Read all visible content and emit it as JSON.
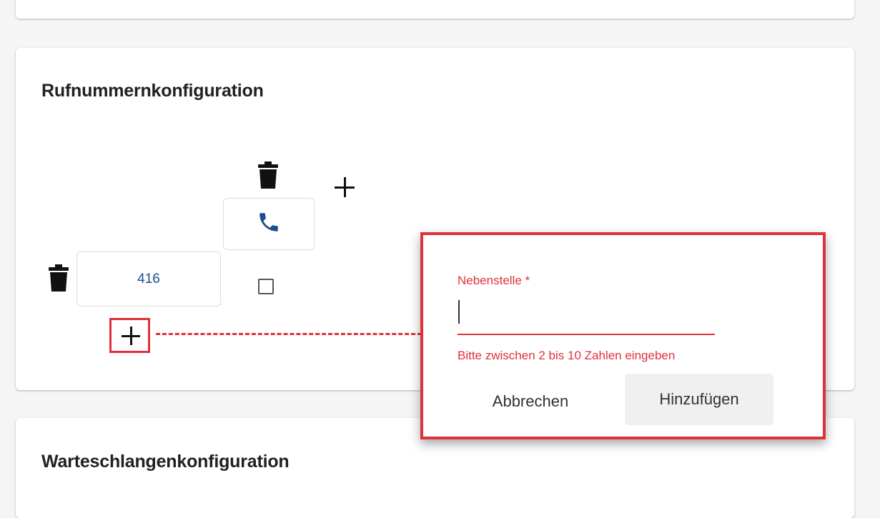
{
  "sections": {
    "number_config_title": "Rufnummernkonfiguration",
    "queue_config_title": "Warteschlangenkonfiguration"
  },
  "number_tree": {
    "root_number": "416"
  },
  "popup": {
    "field_label": "Nebenstelle *",
    "field_value": "",
    "error_message": "Bitte zwischen 2 bis 10 Zahlen eingeben",
    "cancel_label": "Abbrechen",
    "add_label": "Hinzufügen"
  },
  "colors": {
    "accent_red": "#e0303a",
    "phone_blue": "#1e4f8a"
  },
  "icons": [
    "trash-icon",
    "phone-icon",
    "plus-icon",
    "checkbox-icon"
  ]
}
